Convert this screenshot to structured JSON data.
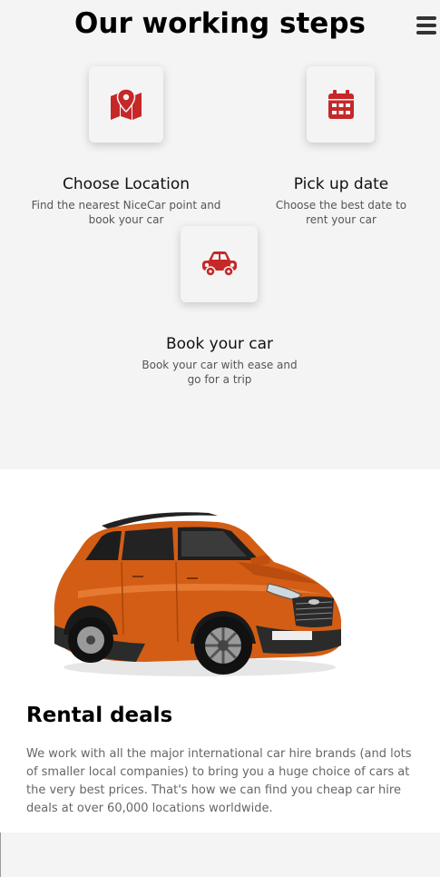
{
  "steps": {
    "title": "Our working steps",
    "items": [
      {
        "title": "Choose Location",
        "description": "Find the nearest NiceCar point and book your car",
        "icon": "map-pin-icon"
      },
      {
        "title": "Pick up date",
        "description": "Choose the best date to rent your car",
        "icon": "calendar-icon"
      },
      {
        "title": "Book your car",
        "description": "Book your car with ease and go for a trip",
        "icon": "car-icon"
      }
    ]
  },
  "rental": {
    "title": "Rental deals",
    "text": "We work with all the major international car hire brands (and lots of smaller local companies) to bring you a huge choice of cars at the very best prices. That's how we can find you cheap car hire deals at over 60,000 locations worldwide."
  },
  "colors": {
    "accent": "#c62828",
    "section_bg": "#f4f4f4",
    "car_body": "#d35d14"
  }
}
